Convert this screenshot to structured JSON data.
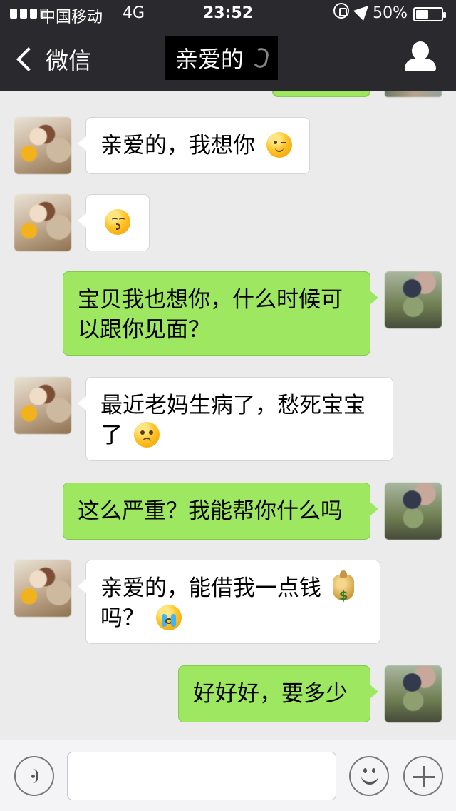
{
  "status_bar": {
    "carrier": "中国移动",
    "network": "4G",
    "time": "23:52",
    "battery_percent_text": "50%",
    "battery_level": 0.5
  },
  "nav": {
    "back_label": "微信",
    "title": "亲爱的",
    "title_icon": "ear-icon",
    "profile_icon": "person-icon"
  },
  "messages": [
    {
      "side": "left",
      "text": "亲爱的，我想你",
      "emoji": "wink"
    },
    {
      "side": "left",
      "text": "",
      "emoji": "kiss"
    },
    {
      "side": "right",
      "text": "宝贝我也想你，什么时候可以跟你见面？",
      "emoji": ""
    },
    {
      "side": "left",
      "text": "最近老妈生病了，愁死宝宝了",
      "emoji": "worried"
    },
    {
      "side": "right",
      "text": "这么严重？我能帮你什么吗",
      "emoji": ""
    },
    {
      "side": "left",
      "text": "亲爱的，能借我一点钱",
      "emoji": "money",
      "text2": "吗？",
      "emoji2": "cry"
    },
    {
      "side": "right",
      "text": "好好好，要多少",
      "emoji": ""
    }
  ],
  "input": {
    "value": "",
    "placeholder": ""
  }
}
